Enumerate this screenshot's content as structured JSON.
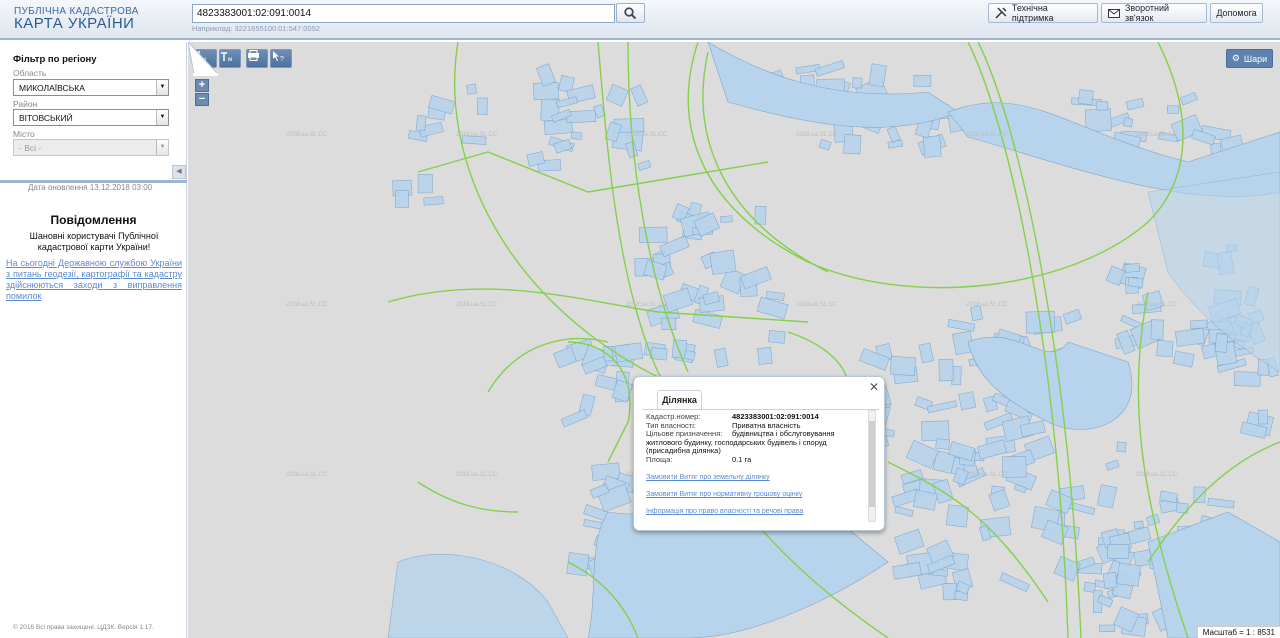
{
  "header": {
    "logo_line1": "ПУБЛІЧНА КАДАСТРОВА",
    "logo_line2": "КАРТА УКРАЇНИ",
    "search_value": "4823383001:02:091:0014",
    "search_hint": "Наприклад: 3221655100:01:547:0052",
    "buttons": {
      "support": "Технічна підтримка",
      "feedback": "Зворотний зв'язок",
      "help": "Допомога"
    }
  },
  "sidebar": {
    "filter_title": "Фільтр по регіону",
    "oblast_label": "Область",
    "oblast_value": "МИКОЛАЇВСЬКА",
    "rayon_label": "Район",
    "rayon_value": "ВІТОВСЬКИЙ",
    "city_label": "Місто",
    "city_value": "- Всі -",
    "updated": "Дата оновлення  13.12.2018 03:00",
    "message_title": "Повідомлення",
    "message_body": "Шановні користувачі Публічної кадастрової карти України!",
    "message_link": "На сьогодні Державною службою України з питань геодезії, картографії та кадастру здійснюються заходи з виправлення помилок",
    "copyright": "© 2016 Всі права захищені. ЦДЗК. Версія 1.17."
  },
  "map": {
    "layers_label": "Шари",
    "zoom_in": "+",
    "zoom_out": "−",
    "scale_text": "Масштаб = 1 : 8531",
    "watermark": "2018.ua.SL.CC",
    "colors": {
      "parcel_fill": "#b8d4ec",
      "parcel_stroke": "#7ea6cc",
      "boundary": "#84d04a",
      "background": "#dcdcdc"
    }
  },
  "popup": {
    "tab": "Ділянка",
    "fields": [
      {
        "key": "Кадастр.номер:",
        "value": "4823383001:02:091:0014"
      },
      {
        "key": "Тип власності:",
        "value": "Приватна власність"
      },
      {
        "key": "Цільове призначення:",
        "value": "будівництва і обслуговування"
      }
    ],
    "purpose_wrap": "житлового будинку, господарських будівель і споруд (присадибна ділянка)",
    "area_key": "Площа:",
    "area_value": "0.1 га",
    "links": [
      "Замовити Витяг про земельну ділянку",
      "Замовити Витяг про нормативну грошову оцінку",
      "Інформація про право власності та речові права"
    ]
  }
}
